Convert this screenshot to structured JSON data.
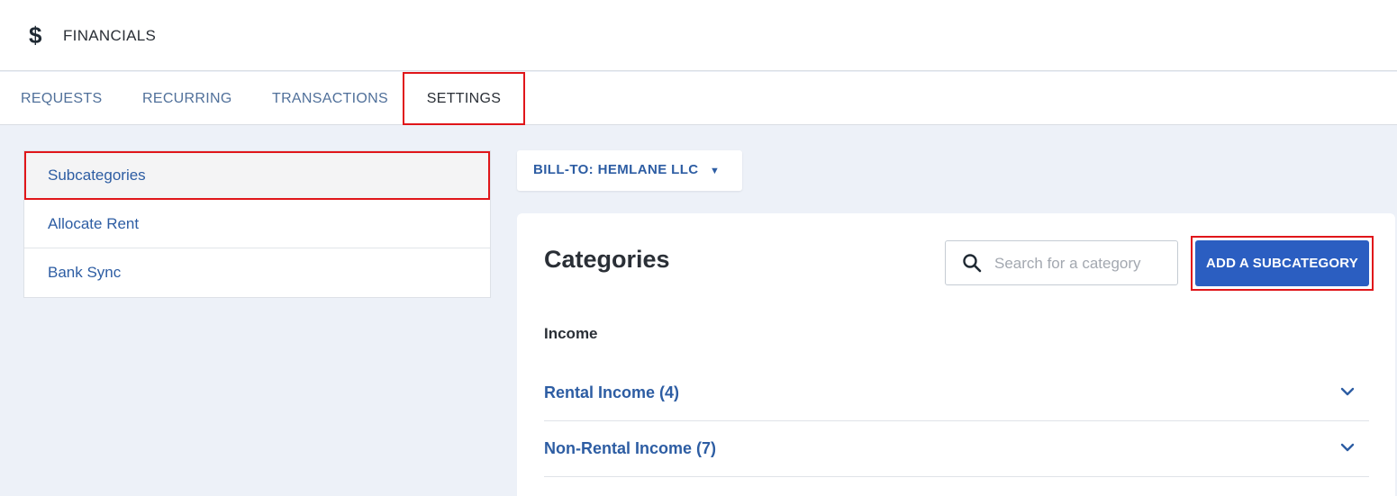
{
  "header": {
    "icon": "dollar-icon",
    "icon_glyph": "$",
    "title": "FINANCIALS"
  },
  "tabs": [
    {
      "label": "REQUESTS",
      "active": false
    },
    {
      "label": "RECURRING",
      "active": false
    },
    {
      "label": "TRANSACTIONS",
      "active": false
    },
    {
      "label": "SETTINGS",
      "active": true
    }
  ],
  "sidebar": {
    "items": [
      {
        "label": "Subcategories",
        "active": true
      },
      {
        "label": "Allocate Rent",
        "active": false
      },
      {
        "label": "Bank Sync",
        "active": false
      }
    ]
  },
  "billto": {
    "label": "BILL-TO: HEMLANE LLC",
    "caret_glyph": "▼",
    "icon": "caret-down-icon"
  },
  "categories": {
    "heading": "Categories",
    "search": {
      "placeholder": "Search for a category",
      "value": ""
    },
    "add_button": "ADD A SUBCATEGORY",
    "group": "Income",
    "rows": [
      {
        "label": "Rental Income (4)"
      },
      {
        "label": "Non-Rental Income (7)"
      }
    ]
  },
  "colors": {
    "accent": "#2b5ec1",
    "link": "#2d5da3",
    "highlight": "#e0161a",
    "background": "#edf1f8"
  }
}
